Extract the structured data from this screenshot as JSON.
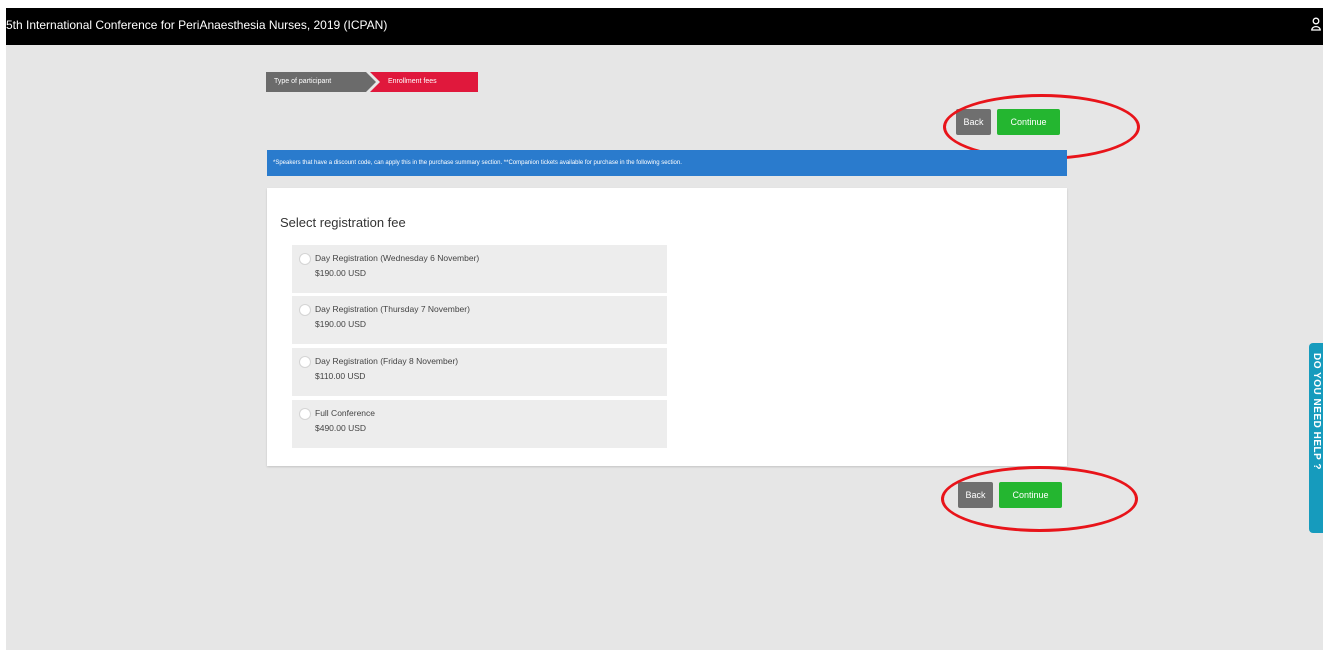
{
  "header": {
    "title": "5th International Conference for PeriAnaesthesia Nurses, 2019 (ICPAN)",
    "user_icon": "user-icon"
  },
  "steps": [
    {
      "label": "Type of participant",
      "state": "completed"
    },
    {
      "label": "Enrollment fees",
      "state": "active"
    }
  ],
  "nav": {
    "back_label": "Back",
    "continue_label": "Continue"
  },
  "banner": {
    "text": "*Speakers that have a discount code, can apply this in the purchase summary section. **Companion tickets available for purchase in the following section."
  },
  "fees": {
    "title": "Select registration fee",
    "options": [
      {
        "label": "Day Registration (Wednesday 6 November)",
        "price": "$190.00 USD"
      },
      {
        "label": "Day Registration (Thursday 7 November)",
        "price": "$190.00 USD"
      },
      {
        "label": "Day Registration (Friday 8 November)",
        "price": "$110.00 USD"
      },
      {
        "label": "Full Conference",
        "price": "$490.00 USD"
      }
    ]
  },
  "help_tab": {
    "label": "DO YOU NEED HELP ?"
  },
  "colors": {
    "topbar": "#000000",
    "page_background": "#e6e6e6",
    "step_completed": "#6b6b6b",
    "step_active": "#e0183c",
    "banner": "#2a7bcd",
    "continue": "#24b630",
    "back": "#6f6f6f",
    "help_tab": "#169bbd",
    "annotation": "#e8141a"
  }
}
